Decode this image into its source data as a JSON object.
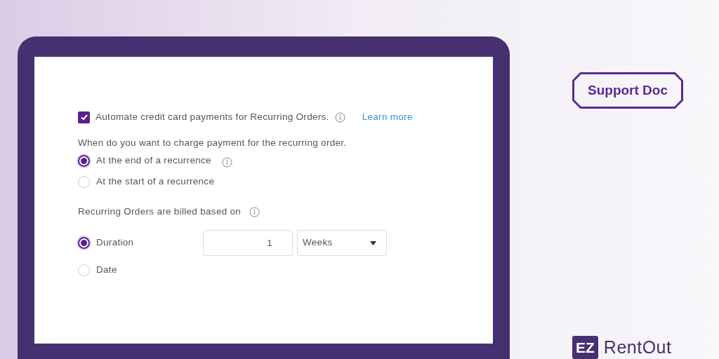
{
  "badge": "Support Doc",
  "logo": {
    "mark": "EZ",
    "name": "RentOut"
  },
  "form": {
    "automate": {
      "label": "Automate credit card payments for Recurring Orders.",
      "checked": true,
      "link": "Learn more"
    },
    "charge_question": "When do you want to charge payment for the recurring order.",
    "charge_options": [
      {
        "label": "At the end of a recurrence",
        "selected": true,
        "info": true
      },
      {
        "label": "At the start of a recurrence",
        "selected": false,
        "info": false
      }
    ],
    "billing_label": "Recurring Orders are billed based on",
    "billing_options": [
      {
        "kind": "duration",
        "label": "Duration",
        "selected": true,
        "value": "1",
        "unit": "Weeks"
      },
      {
        "kind": "plain",
        "label": "Date",
        "selected": false
      }
    ]
  }
}
